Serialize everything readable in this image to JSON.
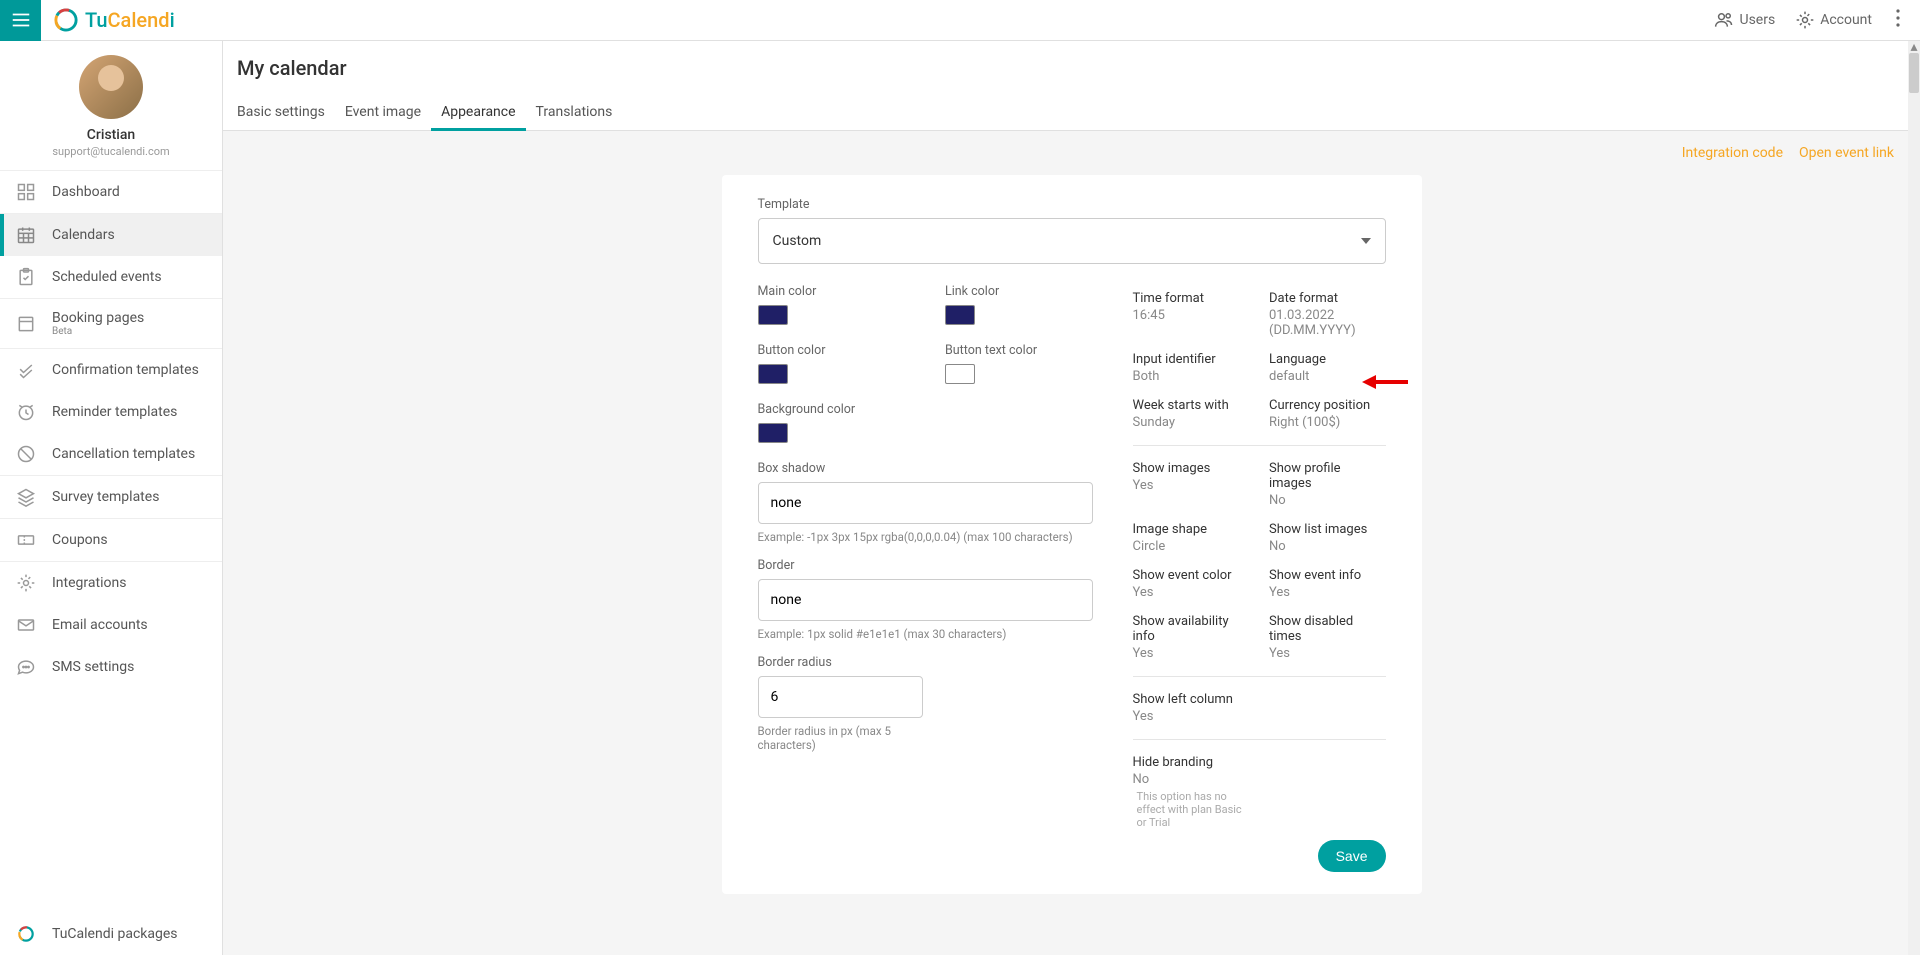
{
  "brand": {
    "tu": "Tu",
    "calend": "Calend",
    "i": "i"
  },
  "top": {
    "users": "Users",
    "account": "Account"
  },
  "user": {
    "name": "Cristian",
    "email": "support@tucalendi.com"
  },
  "nav": {
    "dashboard": "Dashboard",
    "calendars": "Calendars",
    "scheduled": "Scheduled events",
    "booking": "Booking pages",
    "booking_sub": "Beta",
    "confirmation": "Confirmation templates",
    "reminder": "Reminder templates",
    "cancellation": "Cancellation templates",
    "survey": "Survey templates",
    "coupons": "Coupons",
    "integrations": "Integrations",
    "email": "Email accounts",
    "sms": "SMS settings",
    "packages": "TuCalendi packages"
  },
  "page": {
    "title": "My calendar"
  },
  "tabs": {
    "basic": "Basic settings",
    "image": "Event image",
    "appearance": "Appearance",
    "translations": "Translations"
  },
  "actions": {
    "integration": "Integration code",
    "open": "Open event link"
  },
  "template": {
    "label": "Template",
    "value": "Custom"
  },
  "colors": {
    "main_label": "Main color",
    "main_value": "#1f1f66",
    "link_label": "Link color",
    "link_value": "#1f1f66",
    "button_label": "Button color",
    "button_value": "#1f1f66",
    "button_text_label": "Button text color",
    "button_text_value": "#ffffff",
    "bg_label": "Background color",
    "bg_value": "#1f1f66"
  },
  "box_shadow": {
    "label": "Box shadow",
    "value": "none",
    "hint": "Example: -1px 3px 15px rgba(0,0,0,0.04) (max 100 characters)"
  },
  "border": {
    "label": "Border",
    "value": "none",
    "hint": "Example: 1px solid #e1e1e1 (max 30 characters)"
  },
  "radius": {
    "label": "Border radius",
    "value": "6",
    "hint": "Border radius in px (max 5 characters)"
  },
  "props": {
    "time_format": {
      "label": "Time format",
      "value": "16:45"
    },
    "date_format": {
      "label": "Date format",
      "value": "01.03.2022 (DD.MM.YYYY)"
    },
    "input_id": {
      "label": "Input identifier",
      "value": "Both"
    },
    "language": {
      "label": "Language",
      "value": "default"
    },
    "week_start": {
      "label": "Week starts with",
      "value": "Sunday"
    },
    "currency": {
      "label": "Currency position",
      "value": "Right (100$)"
    },
    "show_images": {
      "label": "Show images",
      "value": "Yes"
    },
    "show_profile": {
      "label": "Show profile images",
      "value": "No"
    },
    "image_shape": {
      "label": "Image shape",
      "value": "Circle"
    },
    "show_list": {
      "label": "Show list images",
      "value": "No"
    },
    "show_color": {
      "label": "Show event color",
      "value": "Yes"
    },
    "show_info": {
      "label": "Show event info",
      "value": "Yes"
    },
    "show_avail": {
      "label": "Show availability info",
      "value": "Yes"
    },
    "show_disabled": {
      "label": "Show disabled times",
      "value": "Yes"
    },
    "show_left": {
      "label": "Show left column",
      "value": "Yes"
    },
    "hide_brand": {
      "label": "Hide branding",
      "value": "No",
      "hint": "This option has no effect with plan Basic or Trial"
    }
  },
  "save": "Save"
}
